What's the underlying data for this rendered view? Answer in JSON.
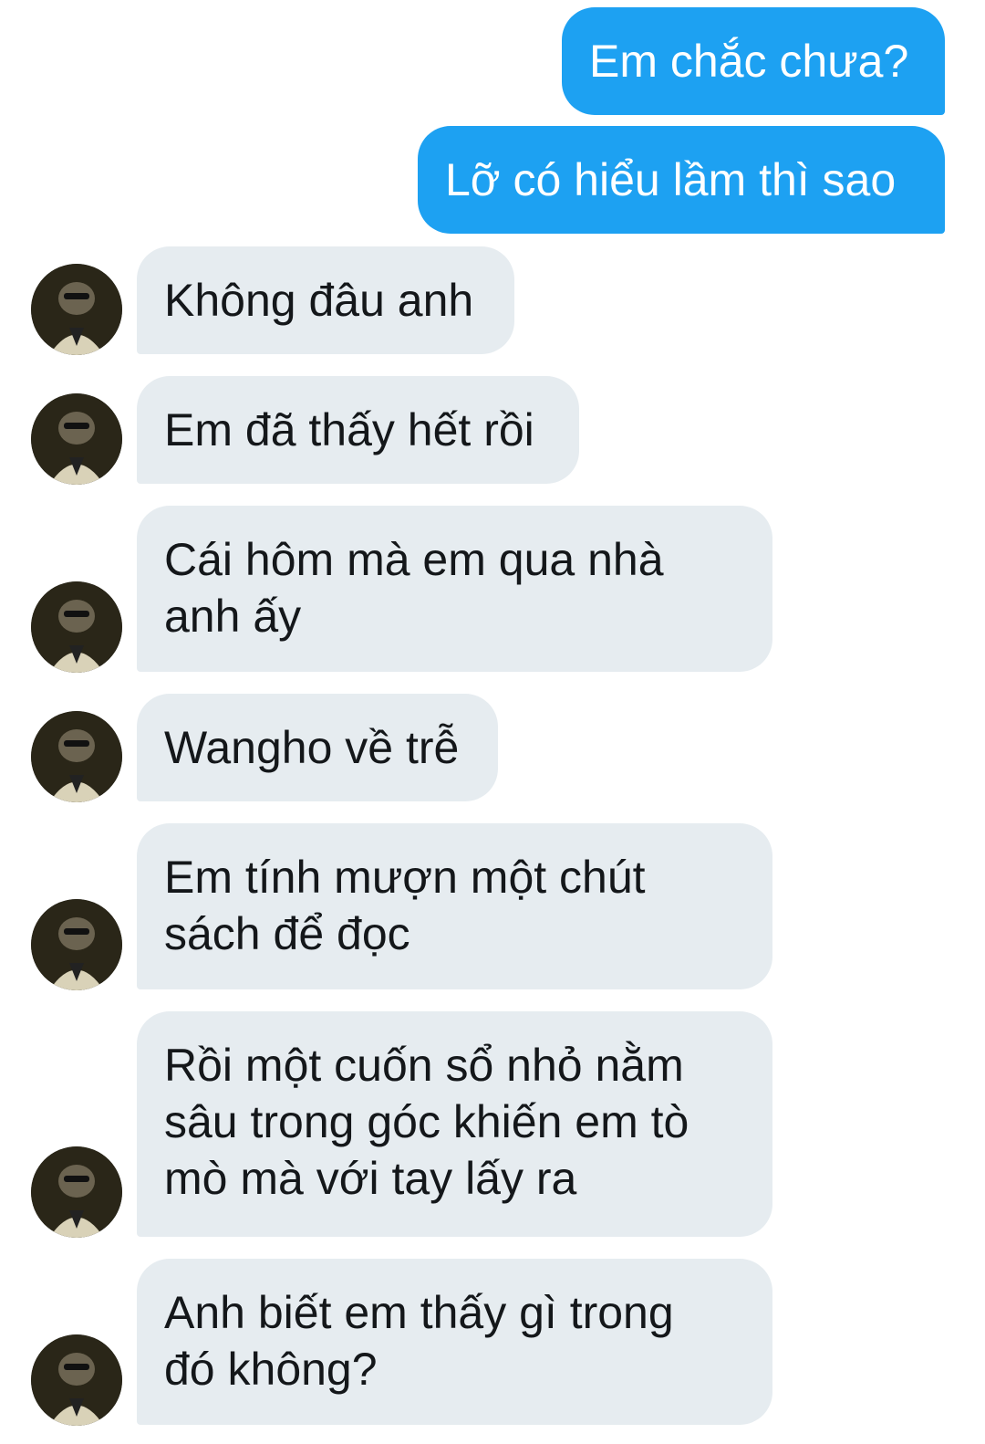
{
  "messages": [
    {
      "direction": "out",
      "text": "Em chắc chưa?"
    },
    {
      "direction": "out",
      "text": "Lỡ có hiểu lầm thì sao"
    },
    {
      "direction": "in",
      "text": "Không đâu anh"
    },
    {
      "direction": "in",
      "text": "Em đã thấy hết rồi"
    },
    {
      "direction": "in",
      "text": "Cái hôm mà em qua nhà\nanh ấy"
    },
    {
      "direction": "in",
      "text": "Wangho về trễ"
    },
    {
      "direction": "in",
      "text": "Em tính mượn một chút\nsách để đọc"
    },
    {
      "direction": "in",
      "text": "Rồi một cuốn sổ nhỏ nằm\nsâu trong góc khiến em tò\nmò mà với tay lấy ra"
    },
    {
      "direction": "in",
      "text": "Anh biết em thấy gì trong\nđó không?"
    }
  ],
  "colors": {
    "outgoing_bubble": "#1da1f2",
    "incoming_bubble": "#e6ecf0",
    "background": "#ffffff"
  },
  "icons": {
    "avatar": "contact-avatar"
  }
}
